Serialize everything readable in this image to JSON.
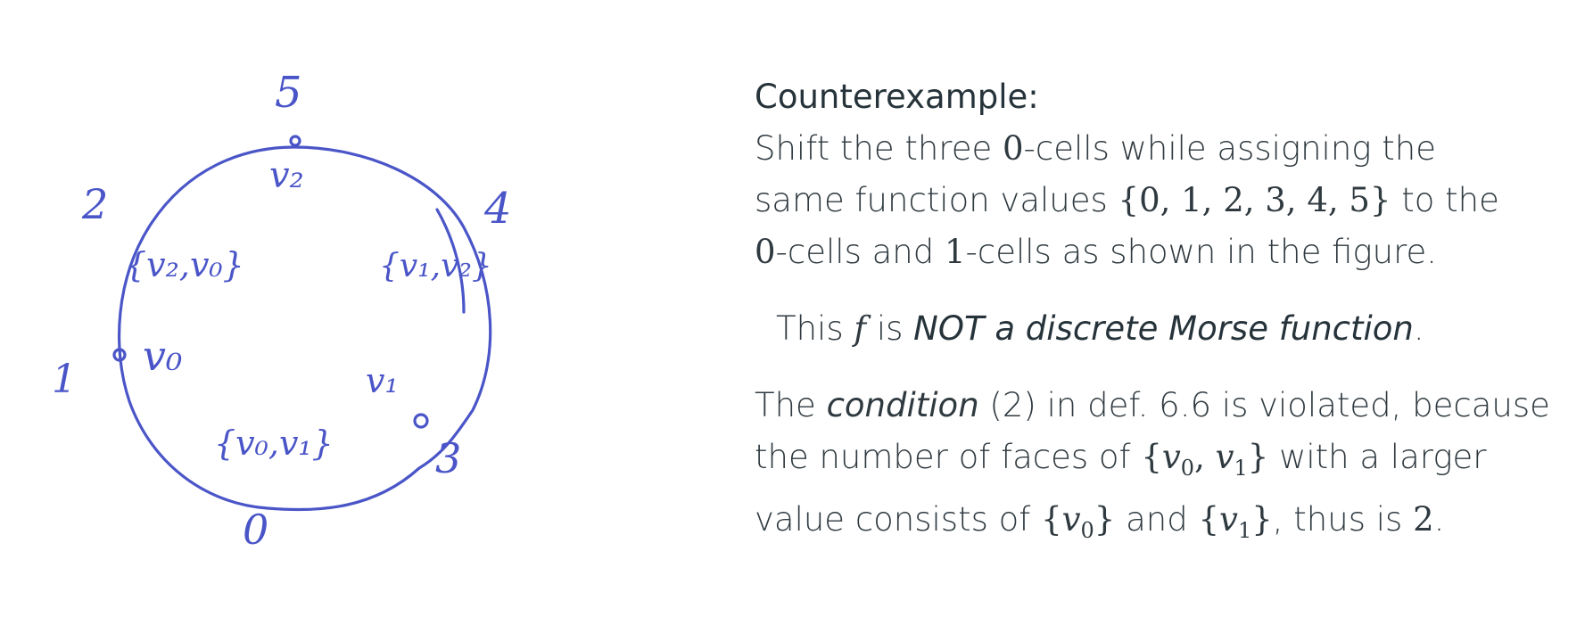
{
  "figure": {
    "labels": {
      "v2": "v₂",
      "v0": "v₀",
      "v1": "v₁",
      "e20": "{v₂,v₀}",
      "e12": "{v₁,v₂}",
      "e01": "{v₀,v₁}",
      "f_v2": "5",
      "f_e20": "2",
      "f_e12": "4",
      "f_v0": "1",
      "f_v1": "3",
      "f_e01": "0"
    }
  },
  "text": {
    "heading": "Counterexample:",
    "p1_a": "Shift the three ",
    "p1_zero": "0",
    "p1_b": "-cells while assigning the",
    "p1_c": "same function values ",
    "p1_set": "{0, 1, 2, 3, 4, 5}",
    "p1_d": " to the",
    "p1_zero2": "0",
    "p1_e": "-cells and ",
    "p1_one": "1",
    "p1_f": "-cells as shown in the figure.",
    "p2_a": "This ",
    "p2_f": "f",
    "p2_b": " is ",
    "p2_em": "NOT a discrete Morse function",
    "p2_c": ".",
    "p3_a": "The ",
    "p3_em": "condition",
    "p3_b": " (2) in def. 6.6 is violated, because",
    "p3_c": "the number of faces of ",
    "p3_brace_open": "{",
    "p3_v": "v",
    "p3_sub0": "0",
    "p3_comma": ", ",
    "p3_sub1": "1",
    "p3_brace_close": "}",
    "p3_d": " with a larger",
    "p3_e": "value consists of ",
    "p3_f": " and ",
    "p3_g": ", thus is ",
    "p3_two": "2",
    "p3_h": "."
  }
}
